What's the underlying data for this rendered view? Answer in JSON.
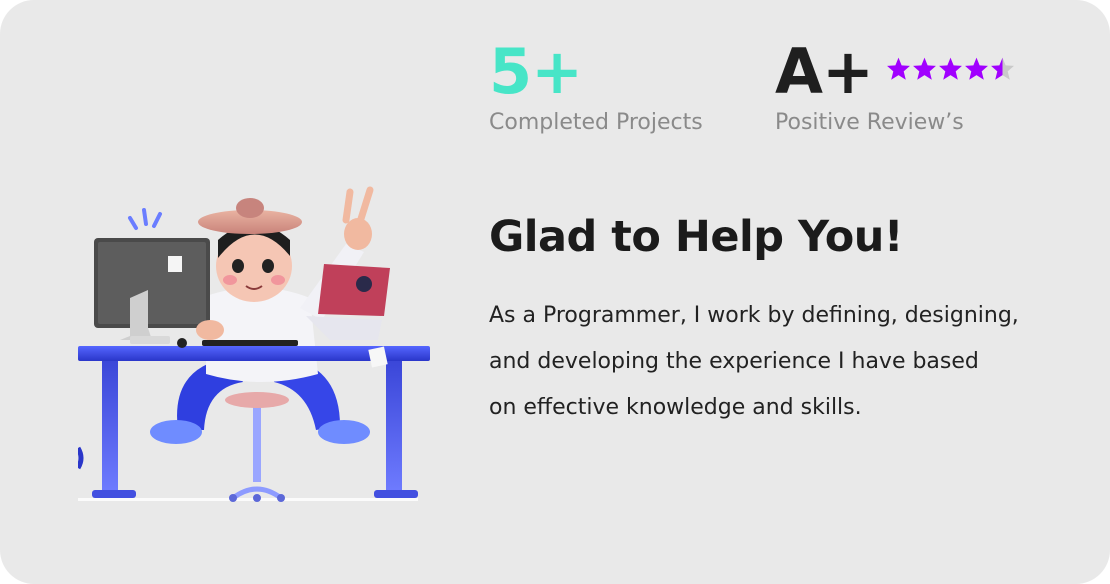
{
  "stats": [
    {
      "value": "5+",
      "label": "Completed Projects"
    },
    {
      "value": "A+",
      "label": "Positive Review’s",
      "rating": 4.5,
      "rating_max": 5
    }
  ],
  "headline": "Glad to Help You!",
  "paragraph_lines": [
    "As a Programmer, I work by defining, designing,",
    "and developing the experience I have based",
    "on effective knowledge and skills."
  ],
  "colors": {
    "card_bg": "#e9e9e9",
    "accent_teal": "#47e5c7",
    "star_purple": "#a100ff",
    "star_empty": "#c9c9c9",
    "headline": "#1b1b1b",
    "label_gray": "#8a8a8a"
  },
  "illustration": {
    "icon": "programmer-at-desk-illustration"
  }
}
